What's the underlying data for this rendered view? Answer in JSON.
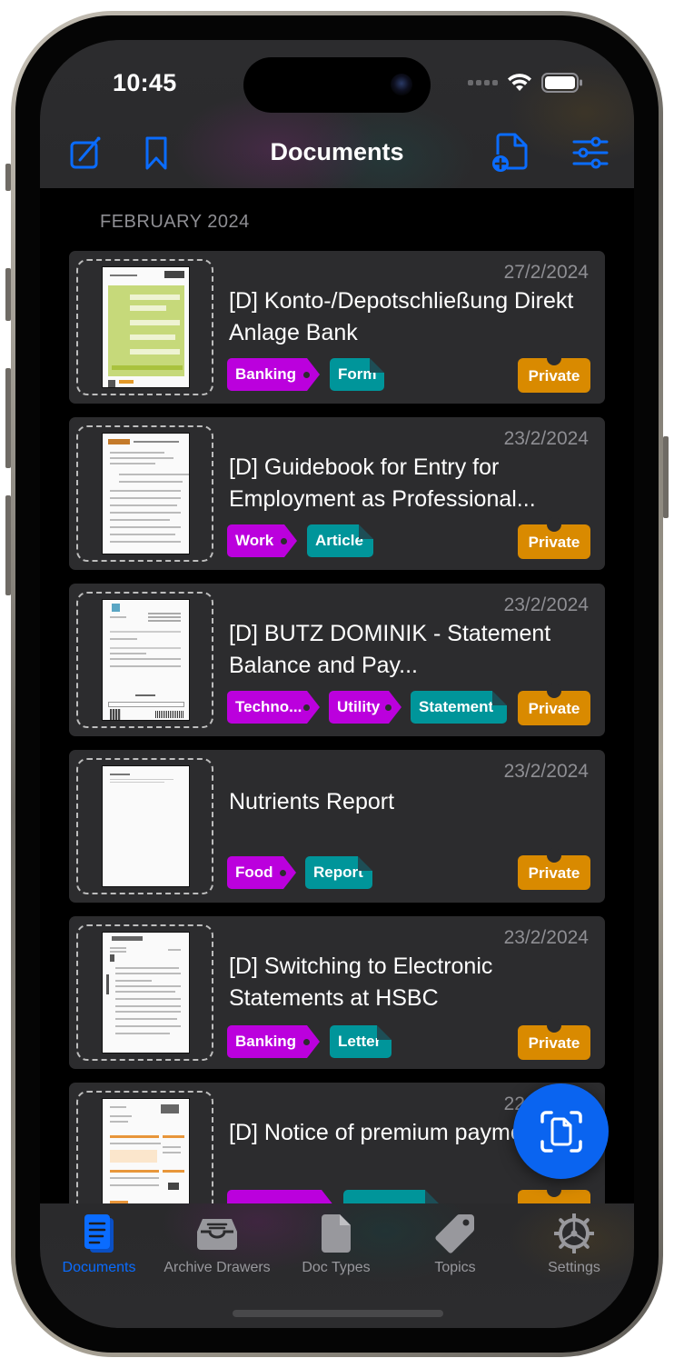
{
  "status_bar": {
    "time": "10:45",
    "icons": [
      "cellular-signal-icon",
      "wifi-icon",
      "battery-icon"
    ]
  },
  "nav_bar": {
    "title": "Documents",
    "left_buttons": [
      {
        "icon": "compose-icon",
        "label": "Edit"
      },
      {
        "icon": "bookmark-icon",
        "label": "Bookmarks"
      }
    ],
    "right_buttons": [
      {
        "icon": "add-document-icon",
        "label": "Add document"
      },
      {
        "icon": "filter-sliders-icon",
        "label": "Filter"
      }
    ],
    "accent_color": "#0a6cff"
  },
  "section": {
    "header": "FEBRUARY 2024"
  },
  "documents": [
    {
      "date": "27/2/2024",
      "title": "[D] Konto-/Depotschließung Direkt Anlage Bank",
      "topics": [
        "Banking"
      ],
      "doc_type": "Form",
      "drawer": "Private",
      "thumbnail": "green-form"
    },
    {
      "date": "23/2/2024",
      "title": "[D] Guidebook for Entry for Employment as Professional...",
      "topics": [
        "Work"
      ],
      "doc_type": "Article",
      "drawer": "Private",
      "thumbnail": "text-article"
    },
    {
      "date": "23/2/2024",
      "title": "[D] BUTZ DOMINIK - Statement Balance and Pay...",
      "topics": [
        "Techno...",
        "Utility"
      ],
      "doc_type": "Statement",
      "drawer": "Private",
      "thumbnail": "statement"
    },
    {
      "date": "23/2/2024",
      "title": "Nutrients Report",
      "topics": [
        "Food"
      ],
      "doc_type": "Report",
      "drawer": "Private",
      "thumbnail": "blank-report"
    },
    {
      "date": "23/2/2024",
      "title": "[D] Switching to Electronic Statements at HSBC",
      "topics": [
        "Banking"
      ],
      "doc_type": "Letter",
      "drawer": "Private",
      "thumbnail": "hsbc-letter"
    },
    {
      "date": "22/2/2024",
      "title": "[D] Notice of premium payment",
      "topics": [
        ""
      ],
      "doc_type": "",
      "drawer": "",
      "thumbnail": "orange-notice"
    }
  ],
  "colors": {
    "topic_tag": "#bb00dd",
    "doc_type_tag": "#00959a",
    "drawer_tag": "#d98a00",
    "card_bg": "#2c2c2e",
    "fab": "#0a64f0"
  },
  "fab": {
    "icon": "scan-document-icon",
    "label": "Scan document"
  },
  "tab_bar": {
    "items": [
      {
        "label": "Documents",
        "icon": "documents-icon",
        "active": true
      },
      {
        "label": "Archive Drawers",
        "icon": "archive-tray-icon",
        "active": false
      },
      {
        "label": "Doc Types",
        "icon": "doc-type-icon",
        "active": false
      },
      {
        "label": "Topics",
        "icon": "tag-icon",
        "active": false
      },
      {
        "label": "Settings",
        "icon": "gear-icon",
        "active": false
      }
    ]
  }
}
